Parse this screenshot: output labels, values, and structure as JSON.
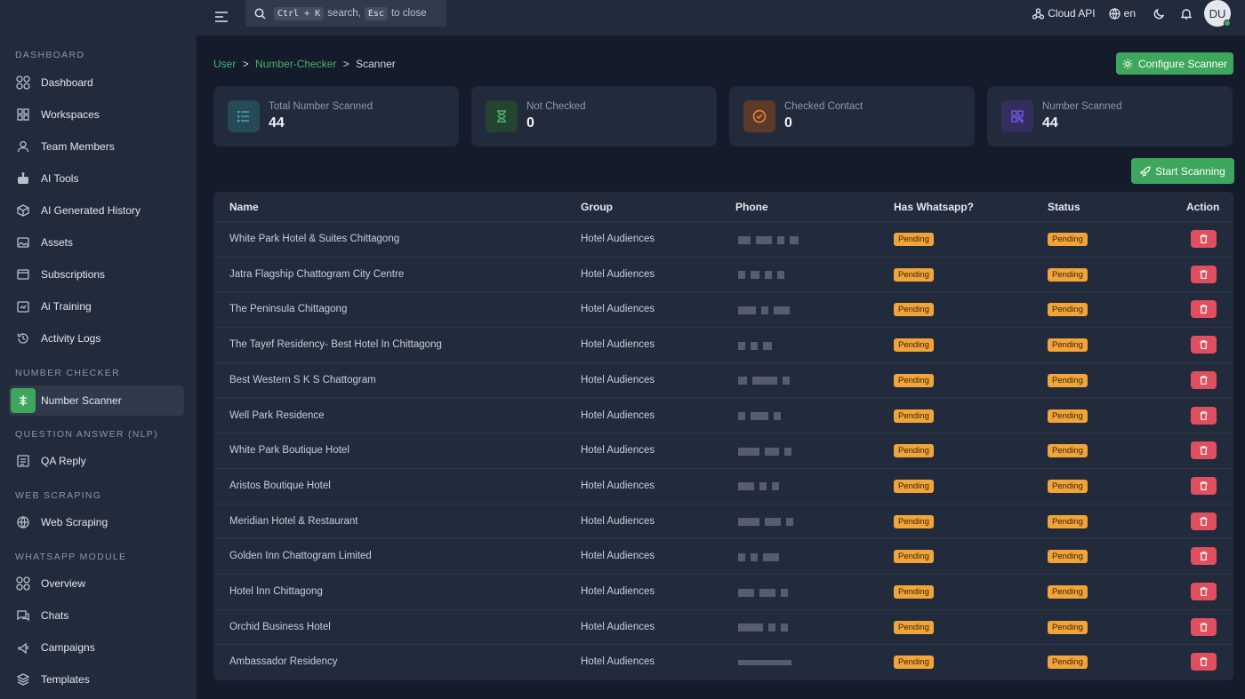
{
  "sidebar": {
    "sections": [
      "DASHBOARD",
      "NUMBER CHECKER",
      "QUESTION ANSWER (NLP)",
      "WEB SCRAPING",
      "WHATSAPP MODULE"
    ],
    "items": [
      {
        "label": "Dashboard",
        "icon": "dashboard-icon"
      },
      {
        "label": "Workspaces",
        "icon": "grid-icon"
      },
      {
        "label": "Team Members",
        "icon": "user-icon"
      },
      {
        "label": "AI Tools",
        "icon": "robot-icon"
      },
      {
        "label": "AI Generated History",
        "icon": "cube-icon"
      },
      {
        "label": "Assets",
        "icon": "image-icon"
      },
      {
        "label": "Subscriptions",
        "icon": "card-icon"
      },
      {
        "label": "Ai Training",
        "icon": "training-icon"
      },
      {
        "label": "Activity Logs",
        "icon": "history-icon"
      },
      {
        "label": "Number Scanner",
        "icon": "scanner-icon"
      },
      {
        "label": "QA Reply",
        "icon": "document-icon"
      },
      {
        "label": "Web Scraping",
        "icon": "globe-icon"
      },
      {
        "label": "Overview",
        "icon": "dashboard-icon"
      },
      {
        "label": "Chats",
        "icon": "chat-icon"
      },
      {
        "label": "Campaigns",
        "icon": "campaign-icon"
      },
      {
        "label": "Templates",
        "icon": "layers-icon"
      }
    ]
  },
  "topbar": {
    "search_kbd1": "Ctrl + K",
    "search_mid": "search,",
    "search_kbd2": "Esc",
    "search_end": "to close",
    "cloud_api": "Cloud API",
    "language": "en",
    "avatar": "DU"
  },
  "breadcrumb": {
    "user": "User",
    "checker": "Number-Checker",
    "current": "Scanner",
    "sep": ">"
  },
  "buttons": {
    "configure": "Configure Scanner",
    "start": "Start Scanning"
  },
  "stats": [
    {
      "label": "Total Number Scanned",
      "value": "44",
      "color": "#2f8f9e"
    },
    {
      "label": "Not Checked",
      "value": "0",
      "color": "#3ea75d"
    },
    {
      "label": "Checked Contact",
      "value": "0",
      "color": "#f08a3a"
    },
    {
      "label": "Number Scanned",
      "value": "44",
      "color": "#7a5af0"
    }
  ],
  "table": {
    "headers": {
      "name": "Name",
      "group": "Group",
      "phone": "Phone",
      "whatsapp": "Has Whatsapp?",
      "status": "Status",
      "action": "Action"
    },
    "rows": [
      {
        "name": "White Park Hotel & Suites Chittagong",
        "group": "Hotel Audiences",
        "whatsapp": "Pending",
        "status": "Pending"
      },
      {
        "name": "Jatra Flagship Chattogram City Centre",
        "group": "Hotel Audiences",
        "whatsapp": "Pending",
        "status": "Pending"
      },
      {
        "name": "The Peninsula Chittagong",
        "group": "Hotel Audiences",
        "whatsapp": "Pending",
        "status": "Pending"
      },
      {
        "name": "The Tayef Residency- Best Hotel In Chittagong",
        "group": "Hotel Audiences",
        "whatsapp": "Pending",
        "status": "Pending"
      },
      {
        "name": "Best Western S K S Chattogram",
        "group": "Hotel Audiences",
        "whatsapp": "Pending",
        "status": "Pending"
      },
      {
        "name": "Well Park Residence",
        "group": "Hotel Audiences",
        "whatsapp": "Pending",
        "status": "Pending"
      },
      {
        "name": "White Park Boutique Hotel",
        "group": "Hotel Audiences",
        "whatsapp": "Pending",
        "status": "Pending"
      },
      {
        "name": "Aristos Boutique Hotel",
        "group": "Hotel Audiences",
        "whatsapp": "Pending",
        "status": "Pending"
      },
      {
        "name": "Meridian Hotel & Restaurant",
        "group": "Hotel Audiences",
        "whatsapp": "Pending",
        "status": "Pending"
      },
      {
        "name": "Golden Inn Chattogram Limited",
        "group": "Hotel Audiences",
        "whatsapp": "Pending",
        "status": "Pending"
      },
      {
        "name": "Hotel Inn Chittagong",
        "group": "Hotel Audiences",
        "whatsapp": "Pending",
        "status": "Pending"
      },
      {
        "name": "Orchid Business Hotel",
        "group": "Hotel Audiences",
        "whatsapp": "Pending",
        "status": "Pending"
      },
      {
        "name": "Ambassador Residency",
        "group": "Hotel Audiences",
        "whatsapp": "Pending",
        "status": "Pending"
      }
    ]
  }
}
